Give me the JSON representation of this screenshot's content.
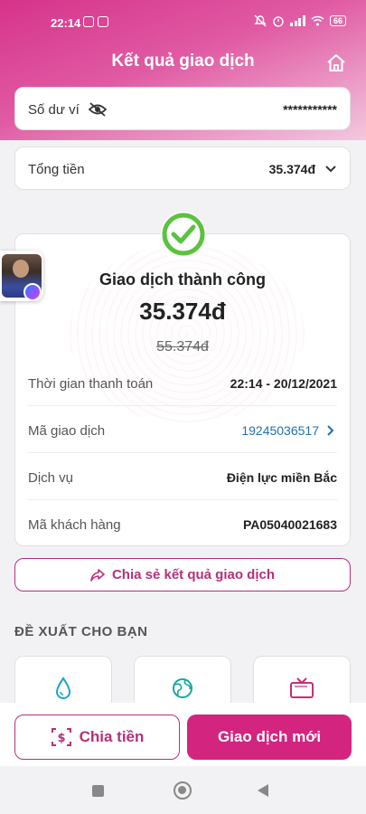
{
  "status_bar": {
    "time": "22:14",
    "battery": "66"
  },
  "header": {
    "title": "Kết quả giao dịch"
  },
  "balance": {
    "label": "Số dư ví",
    "value": "***********"
  },
  "total": {
    "label": "Tổng tiền",
    "value": "35.374đ"
  },
  "result": {
    "title": "Giao dịch thành công",
    "amount": "35.374đ",
    "original_amount": "55.374đ",
    "details": [
      {
        "label": "Thời gian thanh toán",
        "value": "22:14 - 20/12/2021"
      },
      {
        "label": "Mã giao dịch",
        "value": "19245036517"
      },
      {
        "label": "Dịch vụ",
        "value": "Điện lực miền Bắc"
      },
      {
        "label": "Mã khách hàng",
        "value": "PA05040021683"
      }
    ]
  },
  "share": {
    "label": "Chia sẻ kết quả giao dịch"
  },
  "suggestions": {
    "title": "ĐỀ XUẤT CHO BẠN",
    "items": [
      {
        "icon": "water-drop-icon"
      },
      {
        "icon": "globe-icon"
      },
      {
        "icon": "tv-icon"
      }
    ]
  },
  "actions": {
    "split_label": "Chia tiền",
    "new_label": "Giao dịch mới"
  },
  "colors": {
    "brand": "#d3247f",
    "success": "#5cc23f",
    "link": "#1f6fb2"
  }
}
